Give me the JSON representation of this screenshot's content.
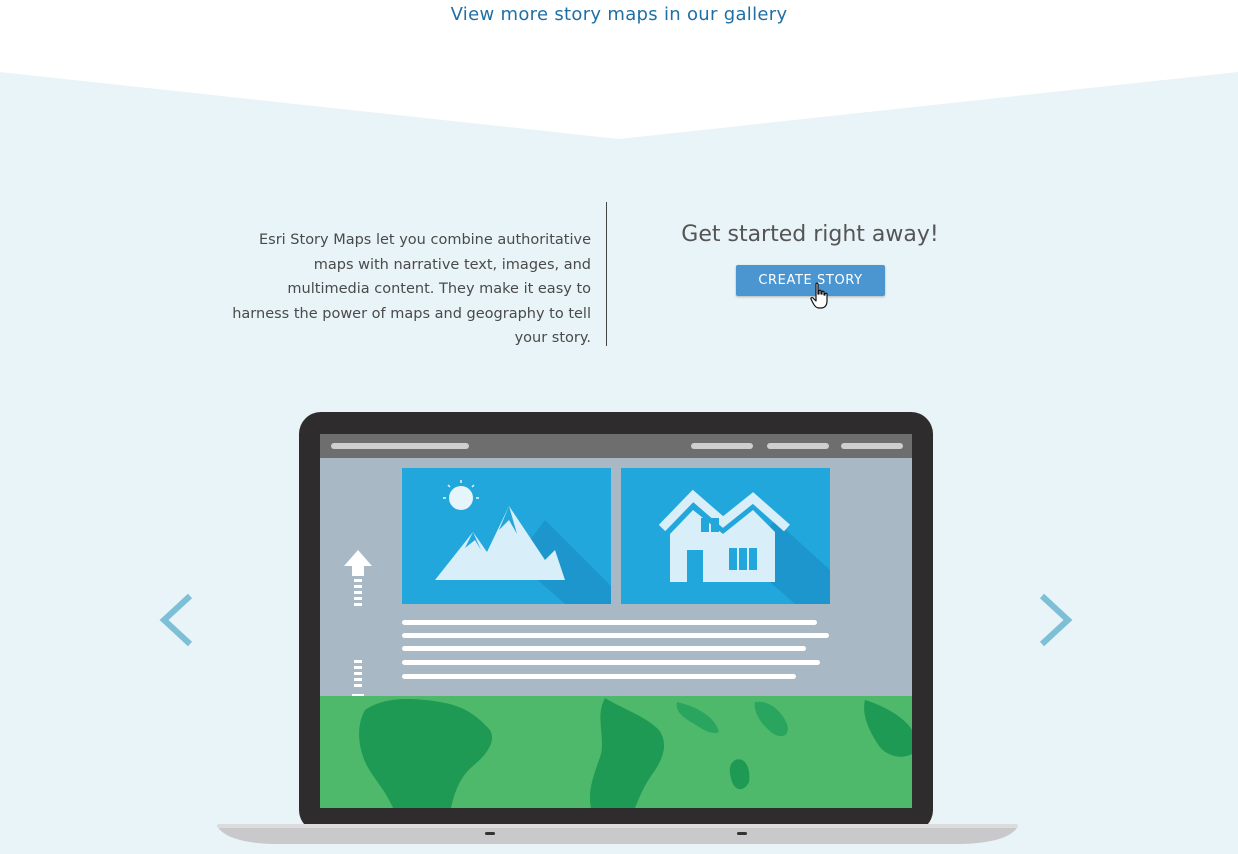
{
  "gallery_link": {
    "text": "View more story maps in our gallery"
  },
  "intro": {
    "description": "Esri Story Maps let you combine authoritative maps with narrative text, images, and multimedia content. They make it easy to harness the power of maps and geography to tell your story."
  },
  "cta": {
    "heading": "Get started right away!",
    "button_label": "CREATE STORY"
  },
  "carousel": {
    "prev_icon": "chevron-left-icon",
    "next_icon": "chevron-right-icon"
  },
  "illustration": {
    "icons": [
      "mountain-sun-icon",
      "house-icon",
      "scroll-up-arrow-icon",
      "scroll-down-arrow-icon"
    ]
  },
  "colors": {
    "background": "#e8f4f7",
    "link": "#1f6fa5",
    "button": "#4b96d1",
    "arrow": "#7cbfd6",
    "screen_blue": "#22a7dc",
    "map_green": "#4fb96b"
  }
}
